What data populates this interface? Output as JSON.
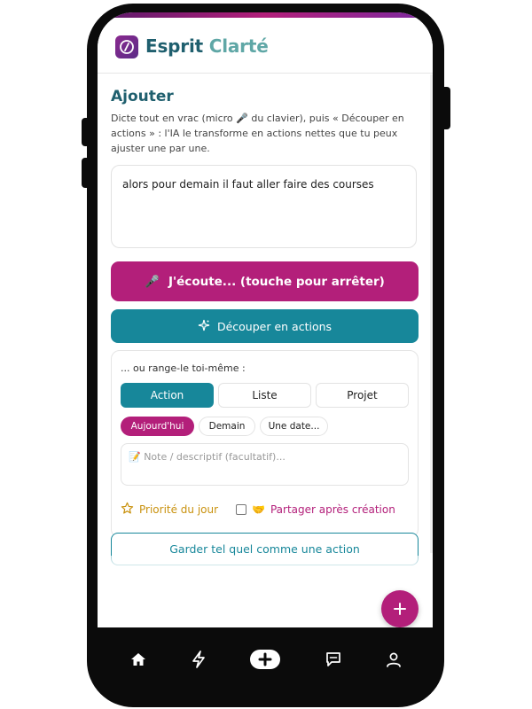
{
  "app": {
    "title_main": "Esprit ",
    "title_accent": "Clarté",
    "brand_color": "#b31f7a",
    "teal_color": "#17879a"
  },
  "add": {
    "title": "Ajouter",
    "description": "Dicte tout en vrac (micro 🎤 du clavier), puis « Découper en actions » : l'IA le transforme en actions nettes que tu peux ajuster une par une.",
    "input_value": "alors pour demain il faut aller faire des courses",
    "record_icon": "🎤",
    "record_label": "J'écoute... (touche pour arrêter)",
    "split_icon": "sparkles-icon",
    "split_label": "Découper en actions"
  },
  "manual": {
    "title": "... ou range-le toi-même :",
    "types": [
      "Action",
      "Liste",
      "Projet"
    ],
    "active_type": "Action",
    "dates": [
      "Aujourd'hui",
      "Demain",
      "Une date..."
    ],
    "active_date": "Aujourd'hui",
    "note_placeholder": "📝 Note / descriptif (facultatif)...",
    "priority_label": "Priorité du jour",
    "share_icon": "🤝",
    "share_label": "Partager après création",
    "keep_label": "Garder tel quel comme une action"
  },
  "nav": {
    "items": [
      "home-icon",
      "lightning-icon",
      "add-icon",
      "chat-icon",
      "profile-icon"
    ]
  }
}
